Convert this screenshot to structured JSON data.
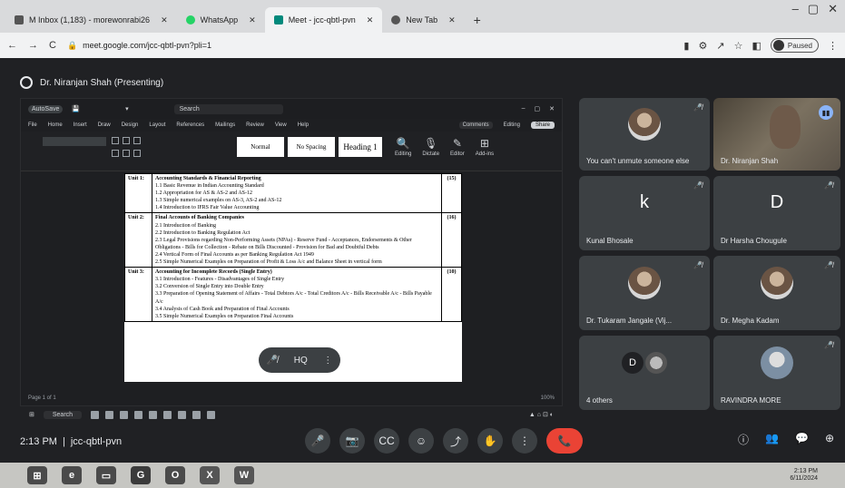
{
  "browser": {
    "tabs": [
      {
        "label": "M Inbox (1,183) - morewonrabi26",
        "icon": "gmail-icon"
      },
      {
        "label": "WhatsApp",
        "icon": "whatsapp-icon"
      },
      {
        "label": "Meet - jcc-qbtl-pvn",
        "icon": "meet-icon",
        "active": true
      },
      {
        "label": "New Tab",
        "icon": "chrome-icon"
      }
    ],
    "url": "meet.google.com/jcc-qbtl-pvn?pli=1",
    "profile_status": "Paused"
  },
  "meet": {
    "presenter_label": "Dr. Niranjan Shah (Presenting)",
    "meeting_time": "2:13 PM",
    "meeting_code": "jcc-qbtl-pvn",
    "share_pill": {
      "hq": "HQ"
    }
  },
  "word": {
    "autosave": "AutoSave",
    "search_placeholder": "Search",
    "menu": [
      "File",
      "Home",
      "Insert",
      "Draw",
      "Design",
      "Layout",
      "References",
      "Mailings",
      "Review",
      "View",
      "Help"
    ],
    "comments_label": "Comments",
    "editing_label": "Editing",
    "share_label": "Share",
    "styles": [
      "Normal",
      "No Spacing",
      "Heading 1"
    ],
    "ribbon_tools": [
      {
        "icon": "🔍",
        "label": "Editing"
      },
      {
        "icon": "🎙",
        "label": "Dictate"
      },
      {
        "icon": "✎",
        "label": "Editor"
      },
      {
        "icon": "⊞",
        "label": "Add-ins"
      }
    ],
    "status_left": "Page 1 of 1",
    "zoom": "100%",
    "syllabus": [
      {
        "unit": "Unit 1:",
        "title": "Accounting Standards & Financial Reporting",
        "marks": "(15)",
        "lines": [
          "1.1 Basic Revenue in Indian Accounting Standard",
          "1.2 Appropriation for AS & AS-2 and AS-12",
          "1.3 Simple numerical examples on AS-3, AS-2 and AS-12",
          "1.4 Introduction to IFRS Fair Value Accounting"
        ]
      },
      {
        "unit": "Unit 2:",
        "title": "Final Accounts of Banking Companies",
        "marks": "(16)",
        "lines": [
          "2.1 Introduction of Banking",
          "2.2 Introduction to Banking Regulation Act",
          "2.3 Legal Provisions regarding Non-Performing Assets (NPAs) - Reserve Fund - Acceptances, Endorsements & Other Obligations - Bills for Collection - Rebate on Bills Discounted - Provision for Bad and Doubtful Debts",
          "2.4 Vertical Form of Final Accounts as per Banking Regulation Act 1949",
          "2.5 Simple Numerical Examples on Preparation of Profit & Loss A/c and Balance Sheet in vertical form"
        ]
      },
      {
        "unit": "Unit 3:",
        "title": "Accounting for Incomplete Records (Single Entry)",
        "marks": "(10)",
        "lines": [
          "3.1 Introduction - Features - Disadvantages of Single Entry",
          "3.2 Conversion of Single Entry into Double Entry",
          "3.3 Preparation of Opening Statement of Affairs - Total Debtors A/c - Total Creditors A/c - Bills Receivable A/c - Bills Payable A/c",
          "3.4 Analysis of Cash Book and Preparation of Final Accounts",
          "3.5 Simple Numerical Examples on Preparation Final Accounts"
        ]
      }
    ]
  },
  "participants": [
    {
      "name": "You can't unmute someone else",
      "type": "photo",
      "muted": true
    },
    {
      "name": "Dr. Niranjan Shah",
      "type": "video",
      "speaking": true
    },
    {
      "name": "Kunal Bhosale",
      "type": "letter",
      "letter": "k",
      "color": "#3c4043",
      "muted": true
    },
    {
      "name": "Dr Harsha Chougule",
      "type": "letter",
      "letter": "D",
      "color": "#3c4043",
      "muted": true
    },
    {
      "name": "Dr. Tukaram Jangale (Vij...",
      "type": "photo",
      "muted": true
    },
    {
      "name": "Dr. Megha Kadam",
      "type": "photo",
      "muted": true
    },
    {
      "name": "4 others",
      "type": "others",
      "letter": "D"
    },
    {
      "name": "RAVINDRA MORE",
      "type": "photo",
      "muted": true
    }
  ],
  "controls": {
    "center": [
      {
        "name": "mic-button",
        "glyph": "🎤"
      },
      {
        "name": "camera-button",
        "glyph": "📷"
      },
      {
        "name": "captions-button",
        "glyph": "CC"
      },
      {
        "name": "emoji-button",
        "glyph": "☺"
      },
      {
        "name": "present-button",
        "glyph": "⤴"
      },
      {
        "name": "raise-hand-button",
        "glyph": "✋"
      },
      {
        "name": "more-options-button",
        "glyph": "⋮"
      },
      {
        "name": "leave-call-button",
        "glyph": "📞"
      }
    ],
    "right": [
      {
        "name": "meeting-details-button",
        "glyph": "ⓘ"
      },
      {
        "name": "people-button",
        "glyph": "👥"
      },
      {
        "name": "chat-button",
        "glyph": "💬"
      },
      {
        "name": "activities-button",
        "glyph": "⊕"
      }
    ]
  },
  "taskbar": {
    "search_label": "Search",
    "clock_time": "2:13 PM",
    "clock_date": "6/11/2024"
  }
}
